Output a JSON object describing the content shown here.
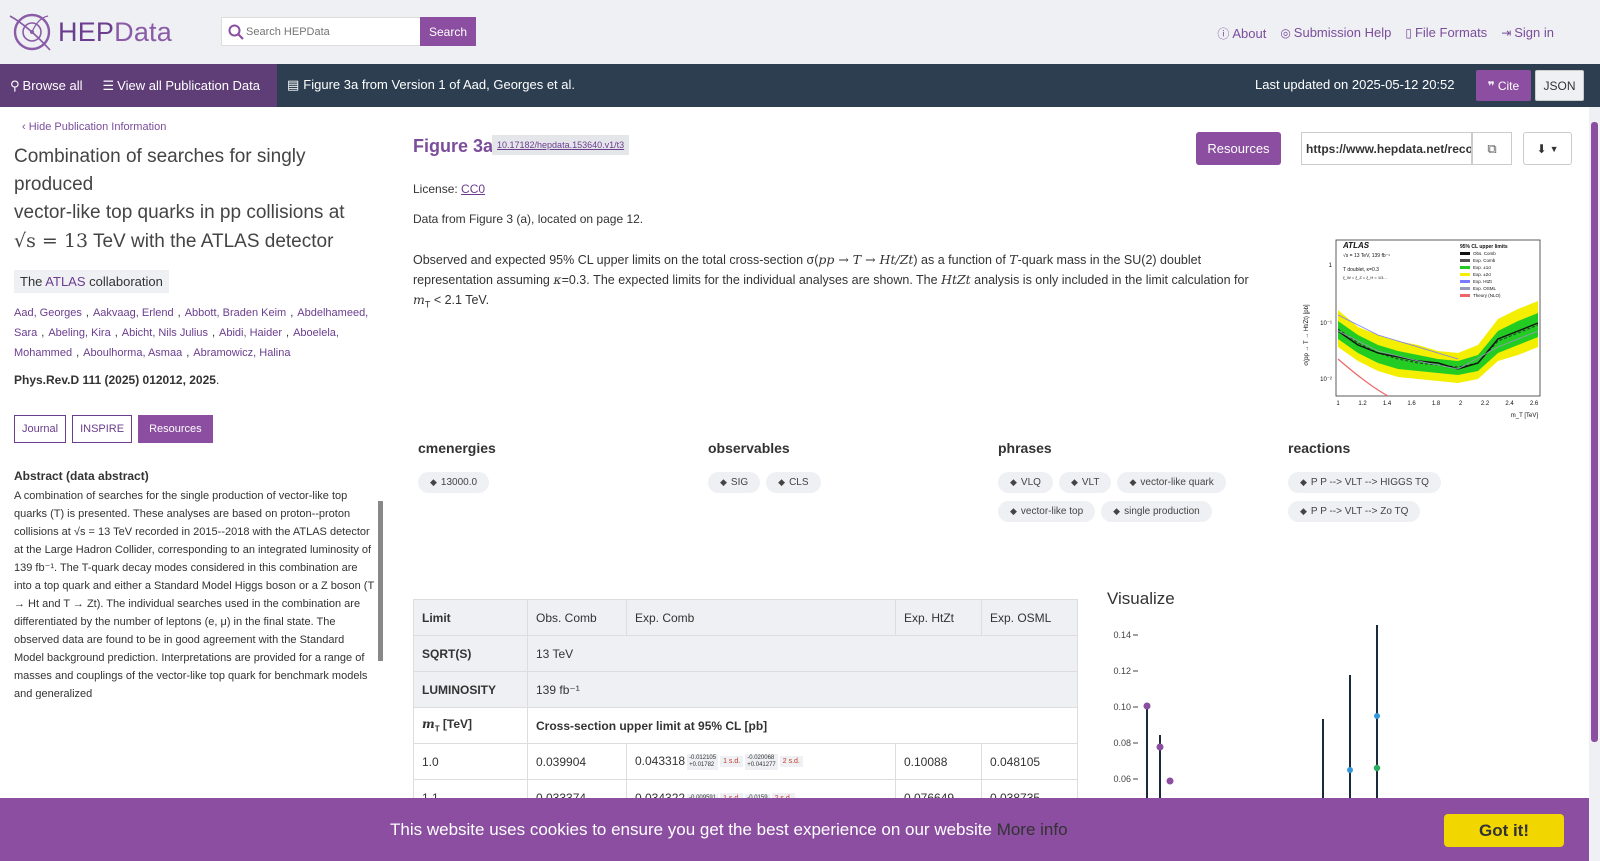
{
  "header": {
    "logo_text_a": "HEP",
    "logo_text_b": "Data",
    "search_placeholder": "Search HEPData",
    "search_button": "Search",
    "links": [
      {
        "icon": "info-icon",
        "label": "About"
      },
      {
        "icon": "lifebuoy-icon",
        "label": "Submission Help"
      },
      {
        "icon": "file-icon",
        "label": "File Formats"
      },
      {
        "icon": "sign-in-icon",
        "label": "Sign in"
      }
    ]
  },
  "nav": {
    "browse_all": "Browse all",
    "view_all": "View all Publication Data",
    "breadcrumb": "Figure 3a from Version 1 of Aad, Georges et al.",
    "last_updated": "Last updated on 2025-05-12 20:52",
    "cite": "Cite",
    "json": "JSON"
  },
  "publication": {
    "hide_label": "Hide Publication Information",
    "title_line1": "Combination of searches for singly produced",
    "title_line2": "vector-like top quarks in pp collisions at",
    "title_line3_math": "√s = 13",
    "title_line3_rest": " TeV with the ATLAS detector",
    "collab_prefix": "The ",
    "collab_link": "ATLAS",
    "collab_suffix": " collaboration",
    "authors": [
      "Aad, Georges",
      "Aakvaag, Erlend",
      "Abbott, Braden Keim",
      "Abdelhameed, Sara",
      "Abeling, Kira",
      "Abicht, Nils Julius",
      "Abidi, Haider",
      "Aboelela, Mohammed",
      "Aboulhorma, Asmaa",
      "Abramowicz, Halina"
    ],
    "journal_ref": "Phys.Rev.D 111 (2025) 012012, 2025",
    "btn_journal": "Journal",
    "btn_inspire": "INSPIRE",
    "btn_resources": "Resources",
    "abstract_title": "Abstract (data abstract)",
    "abstract": "A combination of searches for the single production of vector-like top quarks (T) is presented. These analyses are based on proton--proton collisions at √s = 13 TeV recorded in 2015--2018 with the ATLAS detector at the Large Hadron Collider, corresponding to an integrated luminosity of 139 fb⁻¹. The T-quark decay modes considered in this combination are into a top quark and either a Standard Model Higgs boson or a Z boson (T → Ht and T → Zt). The individual searches used in the combination are differentiated by the number of leptons (e, μ) in the final state. The observed data are found to be in good agreement with the Standard Model background prediction. Interpretations are provided for a range of masses and couplings of the vector-like top quark for benchmark models and generalized"
  },
  "figure": {
    "title": "Figure 3a",
    "doi": "10.17182/hepdata.153640.v1/t3",
    "resources_button": "Resources",
    "url": "https://www.hepdata.net/record/ins2803123?version=1&table=Figure 3a",
    "license_label": "License: ",
    "license_link": "CC0",
    "data_from": "Data from Figure 3 (a), located on page 12.",
    "desc_1": "Observed and expected 95% CL upper limits on the total cross-section σ(",
    "desc_math1": "pp → T → Ht/Zt",
    "desc_2": ") as a function of ",
    "desc_math2": "T",
    "desc_3": "-quark mass in the SU(2) doublet representation assuming ",
    "desc_math3": "κ",
    "desc_4": "=0.3.  The expected limits for the individual analyses are shown. The ",
    "desc_math4": "HtZt",
    "desc_5": " analysis is only included in the limit calculation for ",
    "desc_math5": "m",
    "desc_sub5": "T",
    "desc_6": " < 2.1 TeV.",
    "thumb": {
      "label_atlas": "ATLAS",
      "label_energy": "√s = 13 TeV, 139 fb⁻¹",
      "label_model": "T doublet, κ=0.3",
      "label_coup": "ξ_W = ξ_Z = ξ_H = 1/3...",
      "legend_title": "95% CL upper limits",
      "legend": [
        "Obs. Comb",
        "Exp. Comb",
        "Exp. ±1σ",
        "Exp. ±2σ",
        "Exp. HtZt",
        "Exp. OSML",
        "Theory (NLO)"
      ],
      "ylabel": "σ(pp → T → Ht/Zt) [pb]",
      "xlabel": "m_T [TeV]",
      "xticks": [
        "1",
        "1.2",
        "1.4",
        "1.6",
        "1.8",
        "2",
        "2.2",
        "2.4",
        "2.6"
      ],
      "yticks": [
        "1",
        "10⁻¹",
        "10⁻²"
      ]
    }
  },
  "keywords": [
    {
      "head": "cmenergies",
      "tags": [
        "13000.0"
      ]
    },
    {
      "head": "observables",
      "tags": [
        "SIG",
        "CLS"
      ]
    },
    {
      "head": "phrases",
      "tags": [
        "VLQ",
        "VLT",
        "vector-like quark",
        "vector-like top",
        "single production"
      ]
    },
    {
      "head": "reactions",
      "tags": [
        "P P --> VLT --> HIGGS TQ",
        "P P --> VLT --> Zo TQ"
      ]
    }
  ],
  "table": {
    "headers": [
      "Limit",
      "Obs. Comb",
      "Exp. Comb",
      "Exp. HtZt",
      "Exp. OSML"
    ],
    "sqrts_label": "SQRT(S)",
    "sqrts_value": "13 TeV",
    "lumi_label": "LUMINOSITY",
    "lumi_value": "139 fb⁻¹",
    "mt_label": "m",
    "mt_sub": "T",
    "mt_unit": " [TeV]",
    "qualifier": "Cross-section upper limit at 95% CL [pb]",
    "rows": [
      {
        "x": "1.0",
        "obs": "0.039904",
        "exp": "0.043318",
        "e1m": "-0.012105",
        "e1p": "+0.01782",
        "s1": "1 s.d.",
        "e2m": "-0.020068",
        "e2p": "+0.041277",
        "s2": "2 s.d.",
        "htzt": "0.10088",
        "osml": "0.048105"
      },
      {
        "x": "1.1",
        "obs": "0.033374",
        "exp": "0.034322",
        "e1m": "-0.009591",
        "e1p": "",
        "s1": "1 s.d.",
        "e2m": "-0.0159",
        "e2p": "",
        "s2": "2 s.d.",
        "htzt": "0.076649",
        "osml": "0.038735"
      }
    ]
  },
  "visualize": {
    "title": "Visualize",
    "yticks": [
      "0.14",
      "0.12",
      "0.10",
      "0.08",
      "0.06"
    ]
  },
  "cookie": {
    "text": "This website uses cookies to ensure you get the best experience on our website ",
    "more_info": "More info",
    "button": "Got it!"
  },
  "colors": {
    "brand": "#8b4ea0",
    "nav_dark": "#2c3e50",
    "nav_left": "#5f3d77",
    "cookie_button": "#f1d600"
  }
}
